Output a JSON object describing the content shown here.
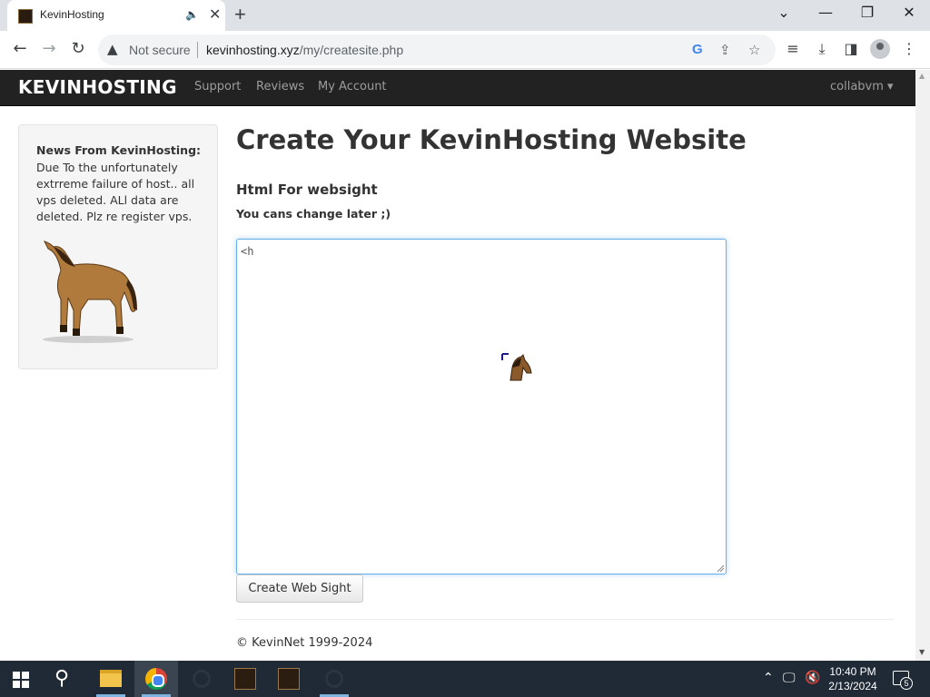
{
  "browser": {
    "tab_title": "KevinHosting",
    "security_label": "Not secure",
    "url_host": "kevinhosting.xyz",
    "url_path": "/my/createsite.php"
  },
  "site": {
    "brand": "KEVINHOSTING",
    "nav": [
      "Support",
      "Reviews",
      "My Account"
    ],
    "user_menu": "collabvm ▾"
  },
  "sidebar": {
    "news_title": "News From KevinHosting:",
    "news_body": "Due To the unfortunately extrreme failure of host.. all vps deleted. ALl data are deleted. Plz re register vps."
  },
  "main": {
    "title": "Create Your KevinHosting Website",
    "html_label": "Html For websight",
    "sub_label": "You cans change later ;)",
    "editor_value": "<h",
    "submit_label": "Create Web Sight",
    "footer": "© KevinNet 1999-2024"
  },
  "taskbar": {
    "time": "10:40 PM",
    "date": "2/13/2024",
    "notification_count": "5"
  },
  "colors": {
    "navbar_bg": "#222222",
    "accent_focus": "#66afe9",
    "taskbar_bg": "#1f2a36"
  }
}
